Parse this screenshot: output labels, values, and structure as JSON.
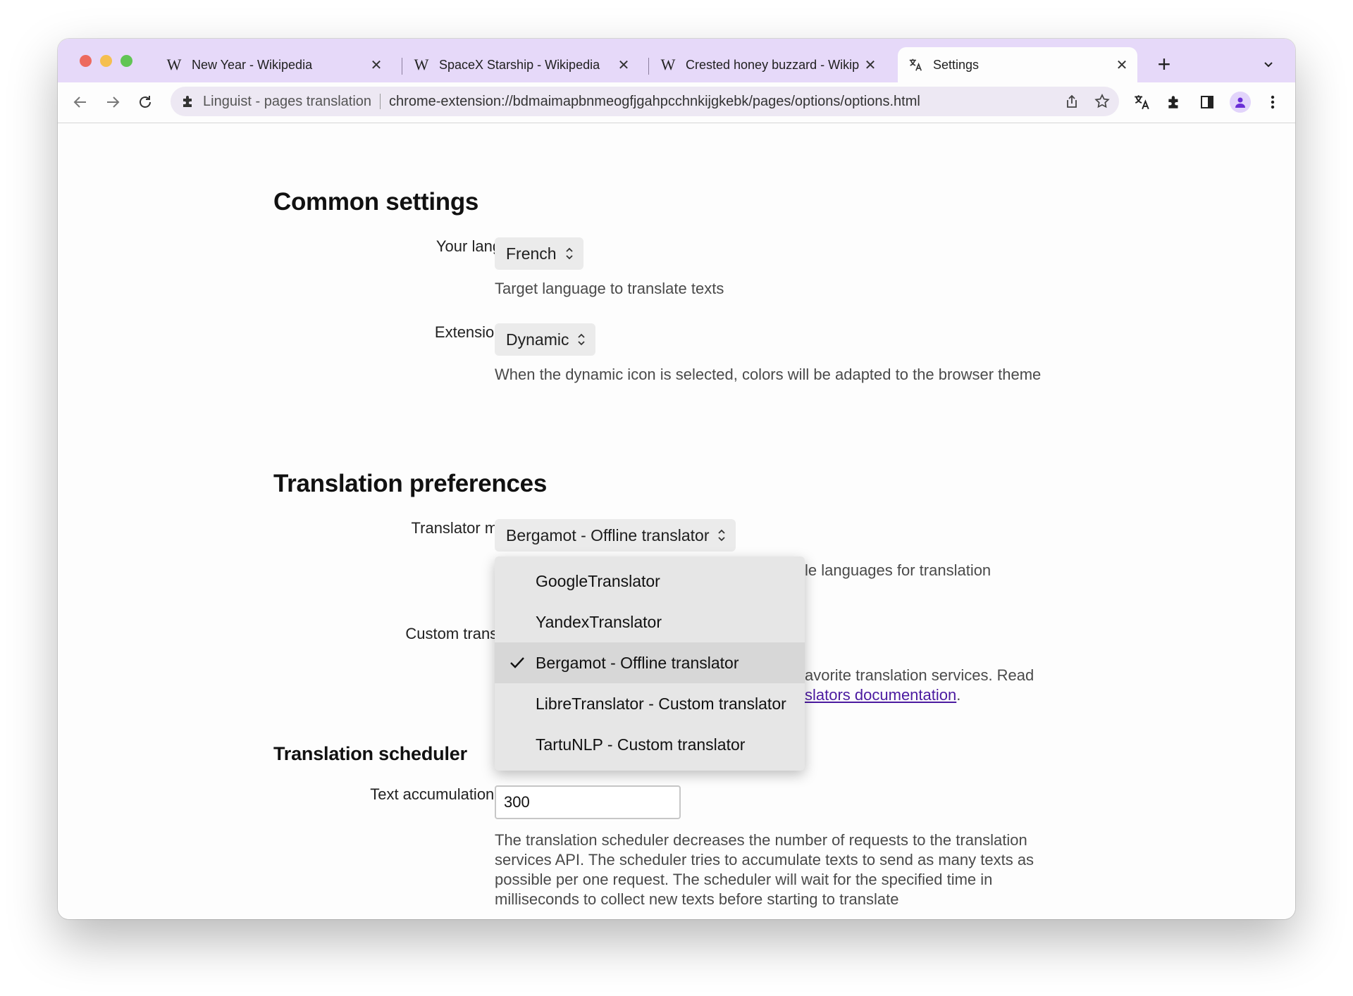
{
  "browser": {
    "tabs": [
      {
        "title": "New Year - Wikipedia",
        "favicon": "W",
        "active": false
      },
      {
        "title": "SpaceX Starship - Wikipedia",
        "favicon": "W",
        "active": false
      },
      {
        "title": "Crested honey buzzard - Wikip",
        "favicon": "W",
        "active": false
      },
      {
        "title": "Settings",
        "favicon": "translate",
        "active": true
      }
    ],
    "close_glyph": "✕",
    "new_tab_glyph": "+",
    "omnibox": {
      "extension_name": "Linguist - pages translation",
      "url": "chrome-extension://bdmaimapbnmeogfjgahpcchnkijgkebk/pages/options/options.html"
    },
    "accent_color": "#e6d9f9"
  },
  "common_settings": {
    "heading": "Common settings",
    "language": {
      "label": "Your language",
      "value": "French",
      "help": "Target language to translate texts"
    },
    "extension_icon": {
      "label": "Extension icon",
      "value": "Dynamic",
      "help": "When the dynamic icon is selected, colors will be adapted to the browser theme"
    }
  },
  "translation_preferences": {
    "heading": "Translation preferences",
    "translator_module": {
      "label": "Translator module",
      "value": "Bergamot - Offline translator",
      "help_visible": "le languages for translation",
      "options": [
        {
          "label": "GoogleTranslator",
          "selected": false
        },
        {
          "label": "YandexTranslator",
          "selected": false
        },
        {
          "label": "Bergamot - Offline translator",
          "selected": true
        },
        {
          "label": "LibreTranslator - Custom translator",
          "selected": false
        },
        {
          "label": "TartuNLP - Custom translator",
          "selected": false
        }
      ]
    },
    "custom_translators": {
      "label": "Custom translators",
      "help_visible_1": "avorite translation services. Read",
      "help_link_visible": "slators documentation",
      "help_tail": "."
    }
  },
  "translation_scheduler": {
    "heading": "Translation scheduler",
    "delay": {
      "label": "Text accumulation delay",
      "value": "300",
      "help": "The translation scheduler decreases the number of requests to the translation services API. The scheduler tries to accumulate texts to send as many texts as possible per one request. The scheduler will wait for the specified time in milliseconds to collect new texts before starting to translate"
    }
  }
}
